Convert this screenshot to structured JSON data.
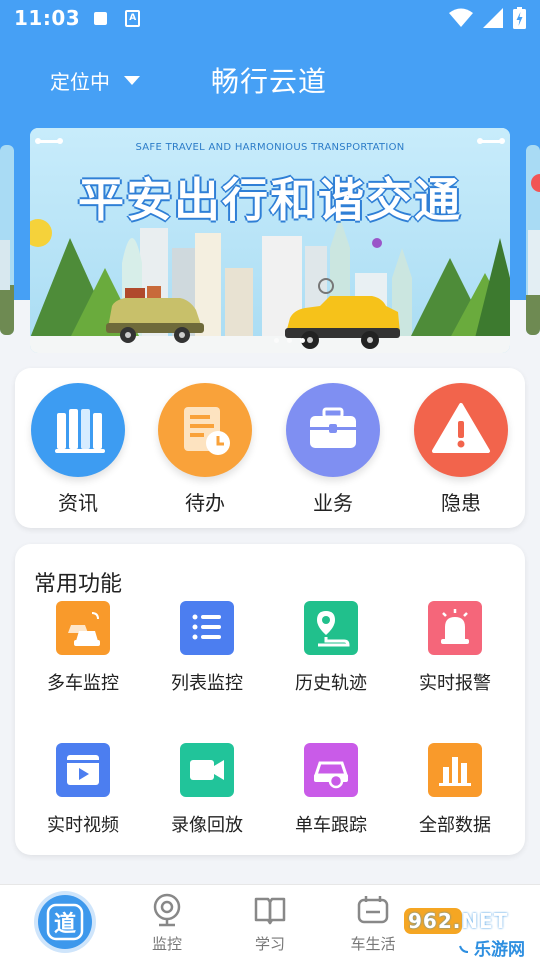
{
  "status_bar": {
    "time": "11:03",
    "a_badge": "A"
  },
  "header": {
    "location": "定位中",
    "title": "畅行云道"
  },
  "banner": {
    "subtitle": "SAFE TRAVEL AND HARMONIOUS TRANSPORTATION",
    "title": "平安出行和谐交通",
    "page_count": 3,
    "active_page": 3
  },
  "quick_actions": [
    {
      "label": "资讯",
      "icon": "books-icon",
      "color": "#3d9cf2"
    },
    {
      "label": "待办",
      "icon": "document-clock-icon",
      "color": "#f9a23a"
    },
    {
      "label": "业务",
      "icon": "briefcase-icon",
      "color": "#7f8ff2"
    },
    {
      "label": "隐患",
      "icon": "warning-icon",
      "color": "#f2644c"
    }
  ],
  "functions": {
    "title": "常用功能",
    "items": [
      {
        "label": "多车监控",
        "icon": "multi-car-icon",
        "color": "#f99a2b"
      },
      {
        "label": "列表监控",
        "icon": "list-icon",
        "color": "#4c7ef0"
      },
      {
        "label": "历史轨迹",
        "icon": "route-icon",
        "color": "#21c08c"
      },
      {
        "label": "实时报警",
        "icon": "alarm-icon",
        "color": "#f5667a"
      },
      {
        "label": "实时视频",
        "icon": "video-icon",
        "color": "#4c7ef0"
      },
      {
        "label": "录像回放",
        "icon": "camera-icon",
        "color": "#21c49a"
      },
      {
        "label": "单车跟踪",
        "icon": "car-track-icon",
        "color": "#c95be8"
      },
      {
        "label": "全部数据",
        "icon": "bar-chart-icon",
        "color": "#f99a2b"
      }
    ]
  },
  "bottom_nav": [
    {
      "label": "",
      "icon": "home-dao-icon",
      "glyph": "道"
    },
    {
      "label": "监控",
      "icon": "webcam-icon"
    },
    {
      "label": "学习",
      "icon": "book-icon"
    },
    {
      "label": "车生活",
      "icon": "car-life-icon"
    }
  ],
  "watermark": {
    "brand": "962.NET",
    "text": "乐游网"
  }
}
